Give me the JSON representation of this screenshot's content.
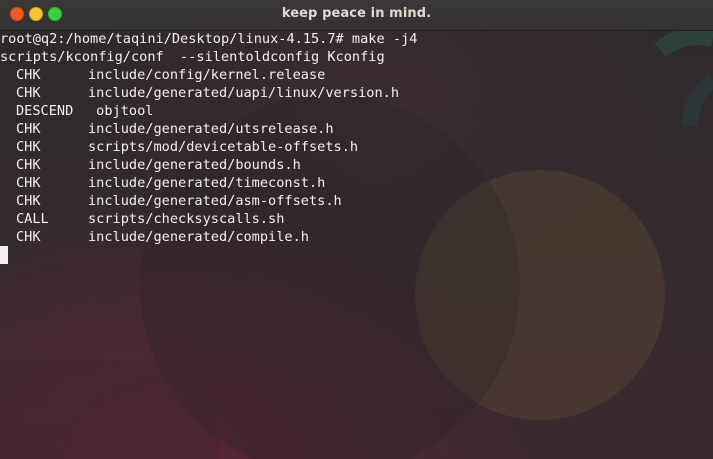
{
  "window": {
    "title": "keep peace in mind."
  },
  "terminal": {
    "prompt_line": "root@q2:/home/taqini/Desktop/linux-4.15.7# make -j4",
    "line2": "scripts/kconfig/conf  --silentoldconfig Kconfig",
    "entries": [
      {
        "cmd": "CHK",
        "path": "include/config/kernel.release"
      },
      {
        "cmd": "CHK",
        "path": "include/generated/uapi/linux/version.h"
      },
      {
        "cmd": "DESCEND",
        "path": " objtool"
      },
      {
        "cmd": "CHK",
        "path": "include/generated/utsrelease.h"
      },
      {
        "cmd": "CHK",
        "path": "scripts/mod/devicetable-offsets.h"
      },
      {
        "cmd": "CHK",
        "path": "include/generated/bounds.h"
      },
      {
        "cmd": "CHK",
        "path": "include/generated/timeconst.h"
      },
      {
        "cmd": "CHK",
        "path": "include/generated/asm-offsets.h"
      },
      {
        "cmd": "CALL",
        "path": "scripts/checksyscalls.sh"
      },
      {
        "cmd": "CHK",
        "path": "include/generated/compile.h"
      }
    ]
  },
  "colors": {
    "close_button": "#ef5a2a",
    "minimize_button": "#f5c230",
    "maximize_button": "#3bcf3b",
    "terminal_text": "#f2f1ed"
  }
}
